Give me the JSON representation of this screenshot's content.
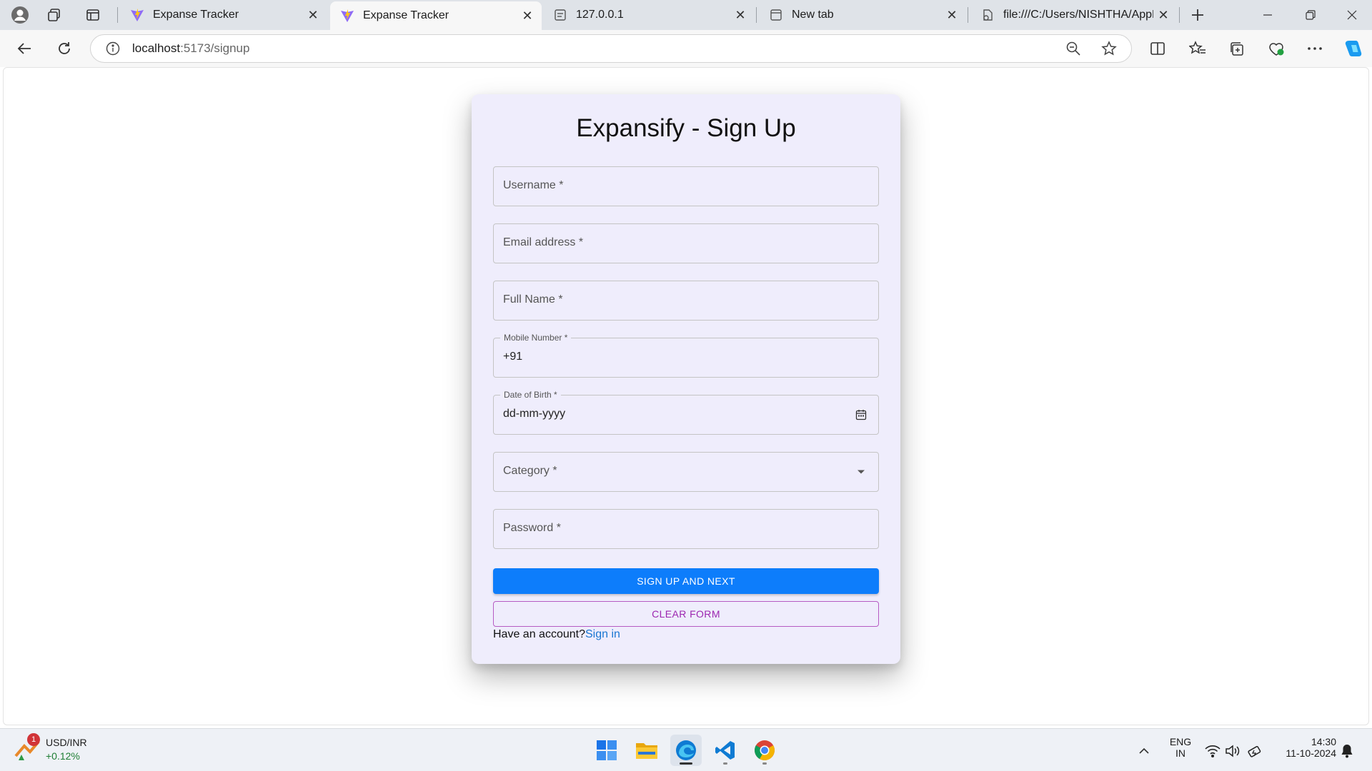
{
  "browser": {
    "tabs": [
      {
        "title": "Expanse Tracker",
        "favicon": "vite-icon",
        "active": false
      },
      {
        "title": "Expanse Tracker",
        "favicon": "vite-icon",
        "active": true
      },
      {
        "title": "127.0.0.1",
        "favicon": "page-icon",
        "active": false
      },
      {
        "title": "New tab",
        "favicon": "new-tab-icon",
        "active": false
      },
      {
        "title": "file:///C:/Users/NISHTHA/AppDat",
        "favicon": "page-icon",
        "active": false
      }
    ],
    "address": {
      "host": "localhost",
      "path": ":5173/signup"
    }
  },
  "form": {
    "title": "Expansify - Sign Up",
    "username_placeholder": "Username *",
    "email_placeholder": "Email address *",
    "fullname_placeholder": "Full Name *",
    "mobile_label": "Mobile Number *",
    "mobile_value": "+91",
    "dob_label": "Date of Birth *",
    "dob_value": "dd-mm-yyyy",
    "category_placeholder": "Category *",
    "password_placeholder": "Password *",
    "submit_label": "SIGN UP AND NEXT",
    "clear_label": "CLEAR FORM",
    "account_prompt": "Have an account?",
    "signin_link": "Sign in"
  },
  "colors": {
    "card_bg": "#efedfc",
    "primary": "#0d7dfb",
    "outline": "#9c27b0",
    "link": "#1976d2"
  },
  "taskbar": {
    "ticker_name": "USD/INR",
    "ticker_change": "+0.12%",
    "ticker_badge": "1",
    "lang_top": "ENG",
    "lang_bottom": "IN",
    "time": "14:30",
    "date": "11-10-2024"
  }
}
